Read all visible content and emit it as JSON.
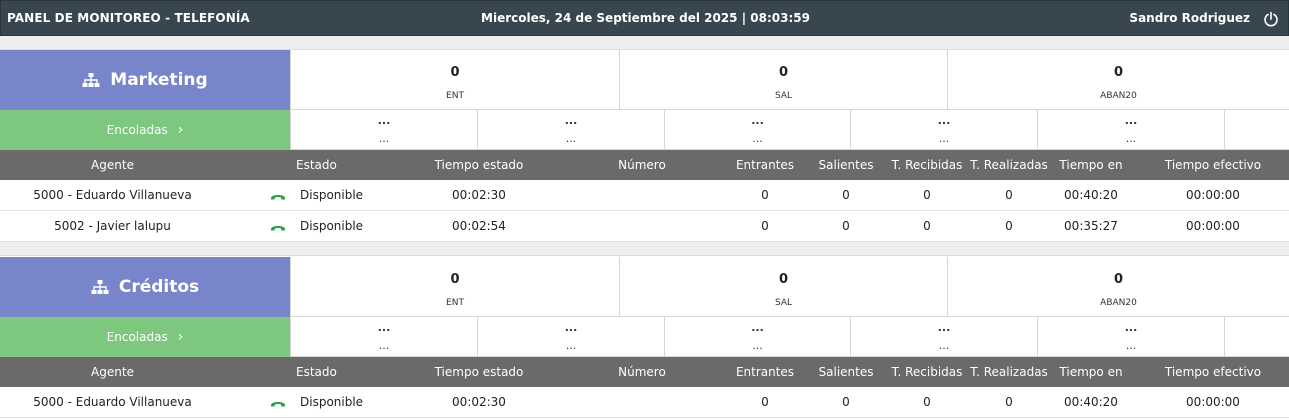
{
  "header": {
    "title": "PANEL DE MONITOREO - TELEFONÍA",
    "datetime": "Miercoles, 24 de Septiembre del 2025 | 08:03:59",
    "user": "Sandro Rodriguez",
    "power_icon": "power-icon"
  },
  "colors": {
    "header_bg": "#37464f",
    "group_bg": "#7985cb",
    "queue_bg": "#7dc77f",
    "table_header_bg": "#6a6a6a",
    "phone_icon": "#2e9d4e"
  },
  "columns": {
    "agente": "Agente",
    "estado": "Estado",
    "tiempo_estado": "Tiempo estado",
    "numero": "Número",
    "entrantes": "Entrantes",
    "salientes": "Salientes",
    "t_recibidas": "T. Recibidas",
    "t_realizadas": "T. Realizadas",
    "tiempo_en": "Tiempo en",
    "tiempo_efectivo": "Tiempo efectivo"
  },
  "groups": [
    {
      "name": "Marketing",
      "stats": [
        {
          "value": "0",
          "label": "ENT"
        },
        {
          "value": "0",
          "label": "SAL"
        },
        {
          "value": "0",
          "label": "ABAN20"
        }
      ],
      "queue_label": "Encoladas",
      "queue_cells": [
        {
          "a": "...",
          "b": "..."
        },
        {
          "a": "...",
          "b": "..."
        },
        {
          "a": "...",
          "b": "..."
        },
        {
          "a": "...",
          "b": "..."
        },
        {
          "a": "...",
          "b": "..."
        },
        {
          "a": "",
          "b": ""
        }
      ],
      "agents": [
        {
          "agente": "5000 - Eduardo Villanueva",
          "estado": "Disponible",
          "tiempo_estado": "00:02:30",
          "numero": "",
          "entrantes": "0",
          "salientes": "0",
          "t_recibidas": "0",
          "t_realizadas": "0",
          "tiempo_en": "00:40:20",
          "tiempo_efectivo": "00:00:00"
        },
        {
          "agente": "5002 - Javier lalupu",
          "estado": "Disponible",
          "tiempo_estado": "00:02:54",
          "numero": "",
          "entrantes": "0",
          "salientes": "0",
          "t_recibidas": "0",
          "t_realizadas": "0",
          "tiempo_en": "00:35:27",
          "tiempo_efectivo": "00:00:00"
        }
      ]
    },
    {
      "name": "Créditos",
      "stats": [
        {
          "value": "0",
          "label": "ENT"
        },
        {
          "value": "0",
          "label": "SAL"
        },
        {
          "value": "0",
          "label": "ABAN20"
        }
      ],
      "queue_label": "Encoladas",
      "queue_cells": [
        {
          "a": "...",
          "b": "..."
        },
        {
          "a": "...",
          "b": "..."
        },
        {
          "a": "...",
          "b": "..."
        },
        {
          "a": "...",
          "b": "..."
        },
        {
          "a": "...",
          "b": "..."
        },
        {
          "a": "",
          "b": ""
        }
      ],
      "agents": [
        {
          "agente": "5000 - Eduardo Villanueva",
          "estado": "Disponible",
          "tiempo_estado": "00:02:30",
          "numero": "",
          "entrantes": "0",
          "salientes": "0",
          "t_recibidas": "0",
          "t_realizadas": "0",
          "tiempo_en": "00:40:20",
          "tiempo_efectivo": "00:00:00"
        }
      ]
    }
  ]
}
